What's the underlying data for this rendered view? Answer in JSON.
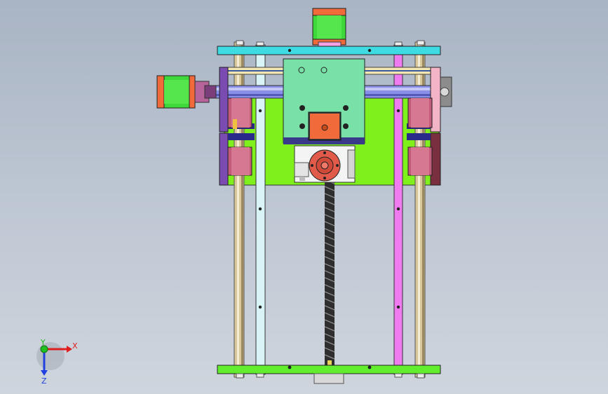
{
  "triad": {
    "x_label": "X",
    "y_label": "Y",
    "z_label": "Z"
  },
  "colors": {
    "background_top": "#a9b4c4",
    "background_bottom": "#cfd5dd",
    "frame_plate": "#7ff01c",
    "top_bar": "#3fdbe2",
    "bottom_bar": "#62ee2f",
    "carriage_plate": "#79e0a8",
    "stepper_body": "#3fd83a",
    "stepper_end": "#f06a3a",
    "guide_rod": "#c9b98c",
    "left_rail": "#d9f4f6",
    "right_rail": "#f07af0",
    "bearing_block": "#c35b7a",
    "end_bracket_left": "#7a4bb0",
    "end_bracket_right": "#f2b4c6",
    "cross_shaft": "#8a8fe8",
    "lead_screw": "#3a3a3a",
    "nut_housing": "#ffffff",
    "nut": "#e25a4a",
    "axis_x": "#e02020",
    "axis_y": "#20c020",
    "axis_z": "#2040e0"
  }
}
